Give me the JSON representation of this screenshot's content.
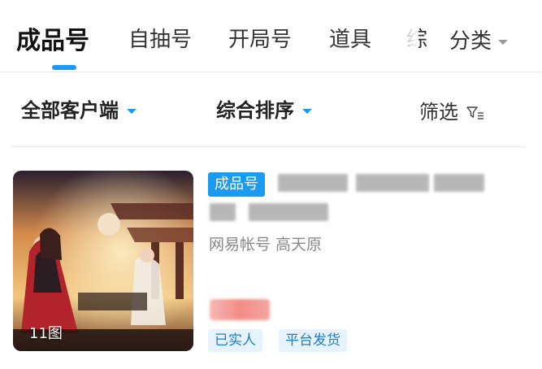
{
  "tabs": [
    {
      "label": "成品号",
      "active": true
    },
    {
      "label": "自抽号",
      "active": false
    },
    {
      "label": "开局号",
      "active": false
    },
    {
      "label": "道具",
      "active": false
    },
    {
      "label": "综",
      "active": false
    }
  ],
  "category": {
    "label": "分类"
  },
  "filters": {
    "client": "全部客户端",
    "sort": "综合排序",
    "screen": "筛选"
  },
  "listing": {
    "image_count": "11图",
    "type_badge": "成品号",
    "meta": "网易帐号  高天原",
    "tags": [
      "已实人",
      "平台发货"
    ]
  },
  "colors": {
    "accent": "#1a9bf0",
    "tag_bg": "#e6f2fc",
    "tag_text": "#1a7fd0"
  }
}
